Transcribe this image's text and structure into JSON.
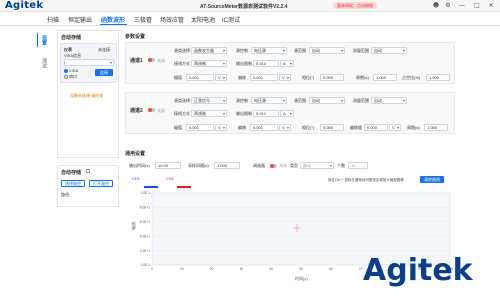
{
  "app": {
    "logo": "Agitek",
    "title": "AT-SourceMeter数源表测试软件V2.2.4",
    "update_label": "暂未授权，点击授权"
  },
  "titlebar_icons": [
    "user-icon",
    "gear-icon",
    "minimize-icon",
    "maximize-icon",
    "close-icon"
  ],
  "menu": {
    "items": [
      "扫描",
      "恒定输出",
      "函数波形",
      "三极管",
      "场效应管",
      "太阳电池",
      "IC测试"
    ],
    "active_index": 2
  },
  "leftnav": {
    "items": [
      "设置",
      "测试"
    ],
    "active_index": 0
  },
  "connect": {
    "title": "自动存储",
    "card_title": "仪表",
    "card_sub": "VISA信息",
    "card_hint": "未连接",
    "resource_value": "",
    "radio_visa": "VISA",
    "radio_com": "串口",
    "connect_button": "连接",
    "link": "设备未连接!请检查"
  },
  "save": {
    "title": "自动存储",
    "select_button": "选择路径",
    "open_button": "打开路径",
    "path_label": "路径:"
  },
  "channels_title": "参数设置",
  "channel1": {
    "title": "通道1",
    "toggle_label": "关闭",
    "row1": [
      {
        "label": "源类选择",
        "value": "函数发生器"
      },
      {
        "label": "源控制",
        "value": "电压源"
      },
      {
        "label": "源范围",
        "value": "自动"
      },
      {
        "label": "测量范围",
        "value": "自动"
      }
    ],
    "row2": [
      {
        "label": "接线方式",
        "value": "两线制"
      },
      {
        "label": "输出限制",
        "value": "0.010",
        "unit": "A"
      }
    ],
    "row3": [
      {
        "label": "幅值",
        "value": "0.001",
        "unit": "V"
      },
      {
        "label": "偏移",
        "value": "0.001",
        "unit": "V"
      },
      {
        "label": "相位(°)",
        "value": "0.000"
      },
      {
        "label": "周期(s)",
        "value": "1.000"
      },
      {
        "label": "占空比(%)",
        "value": "1.000"
      }
    ]
  },
  "channel2": {
    "title": "通道2",
    "toggle_label": "关闭",
    "row1": [
      {
        "label": "源类选择",
        "value": "正弦信号"
      },
      {
        "label": "源控制",
        "value": "电压源"
      },
      {
        "label": "源范围",
        "value": "自动"
      },
      {
        "label": "测量范围",
        "value": "自动"
      }
    ],
    "row2": [
      {
        "label": "接线方式",
        "value": "两线制"
      },
      {
        "label": "输出限制",
        "value": "0.010",
        "unit": "A"
      }
    ],
    "row3": [
      {
        "label": "幅值",
        "value": "0.001",
        "unit": "V"
      },
      {
        "label": "偏移",
        "value": "0.001",
        "unit": "V"
      },
      {
        "label": "相位(°)",
        "value": "0.000"
      },
      {
        "label": "偏移量",
        "value": "0.000",
        "unit": "V"
      },
      {
        "label": "周期(s)",
        "value": "1.000"
      }
    ]
  },
  "general": {
    "title": "通用设置",
    "duration_label": "输出时间(s)",
    "duration_value": "10.00",
    "sample_label": "采样间隔(s)",
    "sample_value": "1.000",
    "toggle_title": "调谐器",
    "toggle_label": "关闭",
    "type_label": "类型",
    "type_value": "移动",
    "count_label": "个数",
    "count_value": "10"
  },
  "plot": {
    "legend": [
      {
        "name": "CH1",
        "color": "#1a4fd6"
      },
      {
        "name": "CH2",
        "color": "#e02020"
      }
    ],
    "hint": "按住Ctrl + 鼠标左键拖动可框选区域放大局部图像",
    "clear_button": "清除曲线",
    "ylabel": "电流",
    "xlabel": "时间(s)"
  },
  "chart_data": {
    "type": "line",
    "title": "",
    "xlabel": "时间(s)",
    "ylabel": "电流",
    "x_ticks": [
      "0",
      "10",
      "20",
      "30",
      "40",
      "50",
      "60",
      "70",
      "80",
      "90",
      "100"
    ],
    "y_ticks": [
      "1.0E-1",
      "8.0E+1",
      "6.0E+1",
      "4.0E+1",
      "2.0E+1",
      "1.0E-1"
    ],
    "xlim": [
      0,
      100
    ],
    "series": [
      {
        "name": "CH1",
        "color": "#1a4fd6",
        "x": [],
        "y": []
      },
      {
        "name": "CH2",
        "color": "#e02020",
        "x": [],
        "y": []
      }
    ],
    "legend": "top-left",
    "grid": true
  },
  "watermark": "Agitek"
}
